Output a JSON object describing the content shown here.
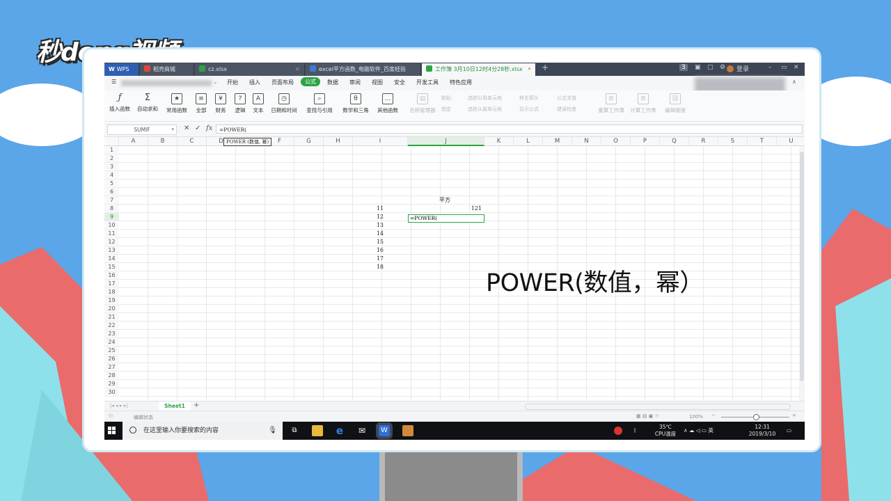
{
  "watermark": {
    "logo_text": "秒dong视频"
  },
  "titlebar": {
    "tabs": [
      {
        "label": "WPS",
        "active": false
      },
      {
        "label": "稻壳商城",
        "active": false
      },
      {
        "label": "cz.xlsx",
        "active": false
      },
      {
        "label": "excel平方函数_电脑软件_百度经验",
        "active": false
      },
      {
        "label": "工作簿 3月10日12时4分28秒.xlsx",
        "active": true
      }
    ],
    "new_tab": "+",
    "badge": "3",
    "user": "登录"
  },
  "menu": {
    "items": [
      "开始",
      "插入",
      "页面布局",
      "公式",
      "数据",
      "审阅",
      "视图",
      "安全",
      "开发工具",
      "特色应用"
    ],
    "active": "公式"
  },
  "ribbon": {
    "buttons": [
      "插入函数",
      "自动求和",
      "常用函数",
      "全部",
      "财务",
      "逻辑",
      "文本",
      "日期和时间",
      "查找与引用",
      "数学和三角",
      "其他函数"
    ],
    "disabled_buttons": [
      "名称管理器",
      "重算工作簿",
      "计算工作表",
      "编辑链接"
    ],
    "small_items": [
      "粘贴",
      "指定",
      "追踪引用单元格",
      "移去箭头",
      "公式求值",
      "追踪从属单元格",
      "显示公式",
      "错误检查"
    ]
  },
  "formula_bar": {
    "name_box": "SUMIF",
    "formula": "=POWER(",
    "tooltip": "POWER (数值, 幂)"
  },
  "columns": [
    "A",
    "B",
    "C",
    "D",
    "E",
    "F",
    "G",
    "H",
    "I",
    "J",
    "K",
    "L",
    "M",
    "N",
    "O",
    "P",
    "Q",
    "R",
    "S",
    "T",
    "U"
  ],
  "selected_column": "J",
  "selected_row": "9",
  "rows": [
    "1",
    "2",
    "3",
    "4",
    "5",
    "6",
    "7",
    "8",
    "9",
    "10",
    "11",
    "12",
    "13",
    "14",
    "15",
    "16",
    "17",
    "18",
    "19",
    "20",
    "21",
    "22",
    "23",
    "24",
    "25",
    "26",
    "27",
    "28",
    "29",
    "30"
  ],
  "cells": {
    "J7": "平方",
    "I8": "11",
    "J8": "121",
    "I9": "12",
    "J9": "=POWER(",
    "I10": "13",
    "I11": "14",
    "I12": "15",
    "I13": "16",
    "I14": "17",
    "I15": "18"
  },
  "sheet": {
    "name": "Sheet1",
    "add": "+"
  },
  "status": {
    "mode": "编辑状态",
    "zoom": "100%"
  },
  "taskbar": {
    "search_placeholder": "在这里输入你要搜索的内容",
    "temp": "35℃",
    "temp_label": "CPU温度",
    "time": "12:31",
    "date": "2019/3/10"
  },
  "overlay_text": "POWER(数值，幂）",
  "colors": {
    "accent": "#2ca444",
    "taskbar": "#101114",
    "sky": "#5aa6e8",
    "mountain": "#ea6b6b"
  }
}
